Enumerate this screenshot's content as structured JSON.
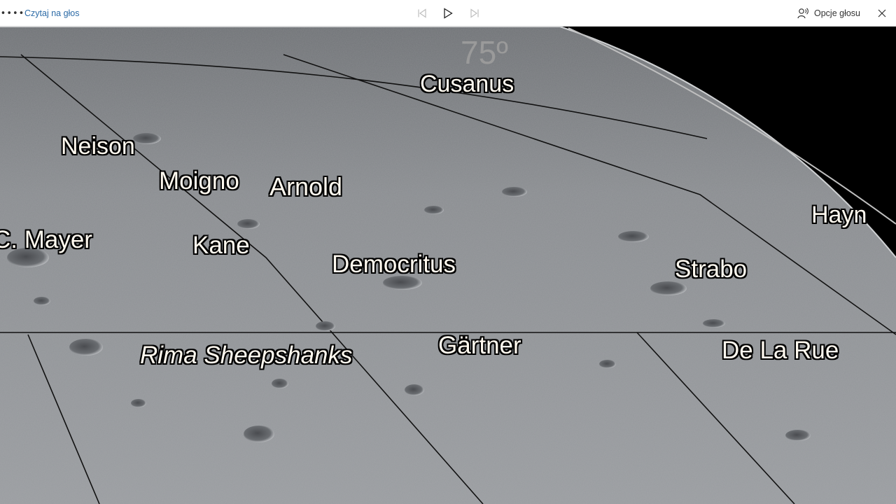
{
  "toolbar": {
    "more_icon": "more-icon",
    "read_aloud_label": "Czytaj na głos",
    "voice_options_label": "Opcje głosu",
    "link_color": "#2b6aa6"
  },
  "scene": {
    "latitude_label": "75º",
    "features": {
      "cusanus": "Cusanus",
      "neison": "Neison",
      "moigno": "Moigno",
      "arnold": "Arnold",
      "hayn": "Hayn",
      "c_mayer": "C. Mayer",
      "kane": "Kane",
      "democritus": "Democritus",
      "strabo": "Strabo",
      "gartner": "Gärtner",
      "rima_sheepshanks": "Rima Sheepshanks",
      "de_la_rue": "De La Rue"
    }
  }
}
